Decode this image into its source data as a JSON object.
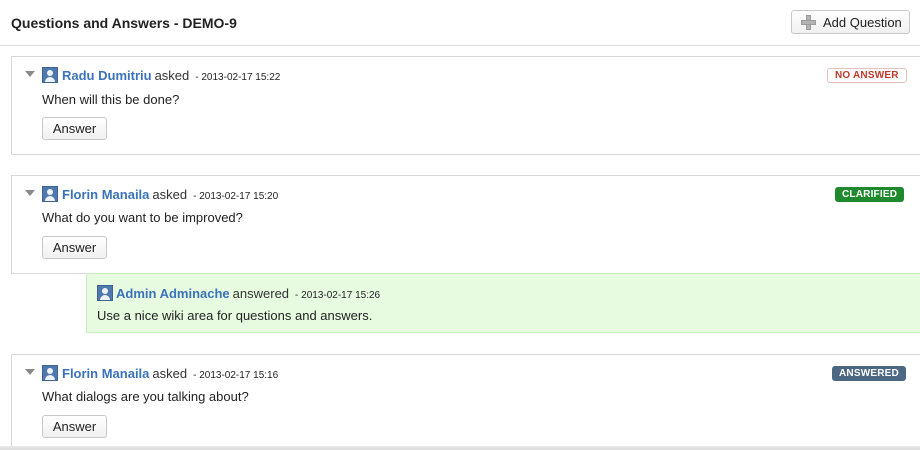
{
  "header": {
    "title": "Questions and Answers - DEMO-9",
    "add_question_label": "Add Question"
  },
  "questions": [
    {
      "author": "Radu Dumitriu",
      "verb": "asked",
      "timestamp": "- 2013-02-17 15:22",
      "text": "When will this be done?",
      "answer_label": "Answer",
      "status": "NO ANSWER"
    },
    {
      "author": "Florin Manaila",
      "verb": "asked",
      "timestamp": "- 2013-02-17 15:20",
      "text": "What do you want to be improved?",
      "answer_label": "Answer",
      "status": "CLARIFIED",
      "reply": {
        "author": "Admin Adminache",
        "verb": "answered",
        "timestamp": "- 2013-02-17 15:26",
        "text": "Use a nice wiki area for questions and answers."
      }
    },
    {
      "author": "Florin Manaila",
      "verb": "asked",
      "timestamp": "- 2013-02-17 15:16",
      "text": "What dialogs are you talking about?",
      "answer_label": "Answer",
      "status": "ANSWERED"
    }
  ],
  "colors": {
    "author_link": "#3b73b9",
    "status_no_answer": "#c0392b",
    "status_clarified": "#1f8a2d",
    "status_answered": "#4c6782",
    "reply_background": "#e6fbe0"
  },
  "icons": {
    "add": "plus-icon",
    "collapse": "triangle-down-icon",
    "user": "user-avatar-icon"
  }
}
